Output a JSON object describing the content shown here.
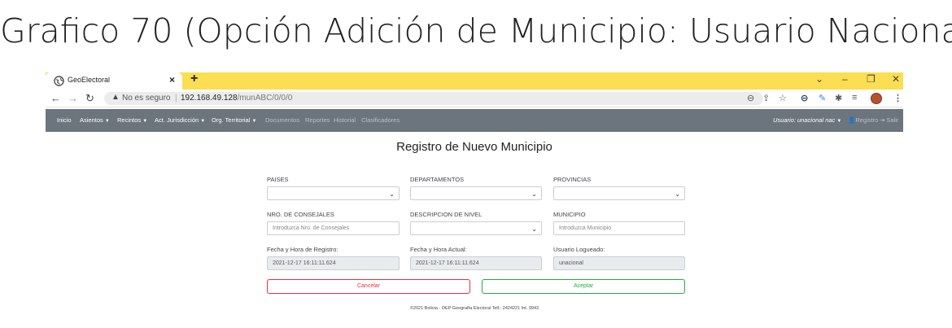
{
  "slide": {
    "title": "Grafico 70 (Opción Adición de Municipio: Usuario Nacional)"
  },
  "browser": {
    "tab_title": "GeoElectoral",
    "tab_close": "×",
    "new_tab": "+",
    "security_text": "No es seguro",
    "separator": "|",
    "url_host": "192.168.49.128",
    "url_path": "/munABC/0/0/0",
    "window_controls": [
      "⌄",
      "–",
      "❐",
      "✕"
    ],
    "toolbar_icons": [
      "zoom-icon",
      "share-icon",
      "star-icon",
      "extension-g-icon",
      "extension-pen-icon",
      "puzzle-icon",
      "reading-list-icon",
      "profile-avatar",
      "menu-dots-icon"
    ]
  },
  "navbar": {
    "items": [
      {
        "label": "Inicio",
        "dropdown": false,
        "dim": false
      },
      {
        "label": "Asientos",
        "dropdown": true,
        "dim": false
      },
      {
        "label": "Recintos",
        "dropdown": true,
        "dim": false
      },
      {
        "label": "Act. Jurisdicción",
        "dropdown": true,
        "dim": false
      },
      {
        "label": "Org. Territorial",
        "dropdown": true,
        "dim": false
      },
      {
        "label": "Documentos",
        "dropdown": false,
        "dim": true
      },
      {
        "label": "Reportes",
        "dropdown": false,
        "dim": true
      },
      {
        "label": "Historial",
        "dropdown": false,
        "dim": true
      },
      {
        "label": "Clasificadores",
        "dropdown": false,
        "dim": true
      }
    ],
    "user_label": "Usuario: unacional nac",
    "registro": "Registro",
    "salir": "Salir"
  },
  "form": {
    "heading": "Registro de Nuevo Municipio",
    "paises_label": "PAISES",
    "departamentos_label": "DEPARTAMENTOS",
    "provincias_label": "PROVINCIAS",
    "consejales_label": "NRO. DE CONSEJALES",
    "consejales_placeholder": "Introduzca Nro. de Consejales",
    "nivel_label": "DESCRIPCION DE NIVEL",
    "municipio_label": "MUNICIPIO",
    "municipio_placeholder": "Introduzca Municipio",
    "fecha_registro_label": "Fecha y Hora de Registro:",
    "fecha_registro_value": "2021-12-17 16:11:11.624",
    "fecha_actual_label": "Fecha y Hora Actual:",
    "fecha_actual_value": "2021-12-17 16:11:11.624",
    "usuario_label": "Usuario Logueado:",
    "usuario_value": "unacional",
    "cancel_label": "Cancelar",
    "accept_label": "Aceptar"
  },
  "footer": {
    "text": "©2021 Bolivia - OEP Geografía Electoral Telf.: 2424221 Int. 9943"
  },
  "colors": {
    "tabstrip": "#fbde51",
    "navbar": "#6c757d",
    "cancel": "#dc3545",
    "accept": "#28a745"
  }
}
